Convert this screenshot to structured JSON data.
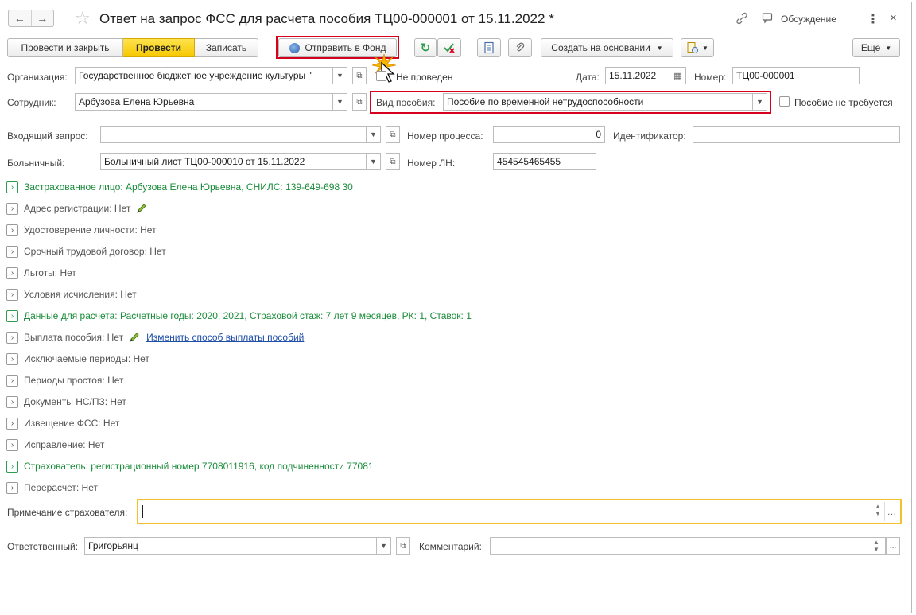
{
  "window": {
    "title": "Ответ на запрос ФСС для расчета пособия ТЦ00-000001 от 15.11.2022 *",
    "discuss_label": "Обсуждение",
    "more_icon": "vertical-dots-icon",
    "close_icon": "close-icon"
  },
  "toolbar": {
    "post_close_label": "Провести и закрыть",
    "post_label": "Провести",
    "save_label": "Записать",
    "send_fund_label": "Отправить в Фонд",
    "create_base_label": "Создать на основании",
    "more_label": "Еще"
  },
  "header": {
    "org_label": "Организация:",
    "org_value": "Государственное бюджетное учреждение культуры \"",
    "status_label": "Не проведен",
    "date_label": "Дата:",
    "date_value": "15.11.2022",
    "number_label": "Номер:",
    "number_value": "ТЦ00-000001",
    "employee_label": "Сотрудник:",
    "employee_value": "Арбузова Елена Юрьевна",
    "benefit_type_label": "Вид пособия:",
    "benefit_type_value": "Пособие по временной нетрудоспособности",
    "not_required_label": "Пособие не требуется",
    "incoming_label": "Входящий запрос:",
    "incoming_value": "",
    "process_label": "Номер процесса:",
    "process_value": "0",
    "identifier_label": "Идентификатор:",
    "identifier_value": "",
    "sick_label": "Больничный:",
    "sick_value": "Больничный лист ТЦ00-000010 от 15.11.2022",
    "ln_label": "Номер ЛН:",
    "ln_value": "454545465455"
  },
  "sections": [
    {
      "text": "Застрахованное лицо: Арбузова Елена Юрьевна, СНИЛС: 139-649-698 30",
      "green": true
    },
    {
      "text": "Адрес регистрации: Нет",
      "green": false,
      "edit": true
    },
    {
      "text": "Удостоверение личности: Нет",
      "green": false
    },
    {
      "text": "Срочный трудовой договор: Нет",
      "green": false
    },
    {
      "text": "Льготы: Нет",
      "green": false
    },
    {
      "text": "Условия исчисления: Нет",
      "green": false
    },
    {
      "text": "Данные для расчета: Расчетные годы: 2020, 2021, Страховой стаж: 7 лет 9 месяцев, РК: 1, Ставок: 1",
      "green": true
    },
    {
      "text": "Выплата пособия: Нет",
      "green": false,
      "edit": true,
      "link": "Изменить способ выплаты пособий"
    },
    {
      "text": "Исключаемые периоды: Нет",
      "green": false
    },
    {
      "text": "Периоды простоя: Нет",
      "green": false
    },
    {
      "text": "Документы НС/ПЗ: Нет",
      "green": false
    },
    {
      "text": "Извещение ФСС: Нет",
      "green": false
    },
    {
      "text": "Исправление: Нет",
      "green": false
    },
    {
      "text": "Страхователь: регистрационный номер 7708011916, код подчиненности 77081",
      "green": true
    },
    {
      "text": "Перерасчет: Нет",
      "green": false
    }
  ],
  "footer": {
    "note_label": "Примечание страхователя:",
    "note_value": "",
    "responsible_label": "Ответственный:",
    "responsible_value": "Григорьянц",
    "comment_label": "Комментарий:",
    "comment_value": ""
  },
  "colors": {
    "accent_yellow": "#f6c800",
    "highlight_red": "#d6001c",
    "section_green": "#1a8c3a",
    "link_blue": "#1f4ea8"
  }
}
